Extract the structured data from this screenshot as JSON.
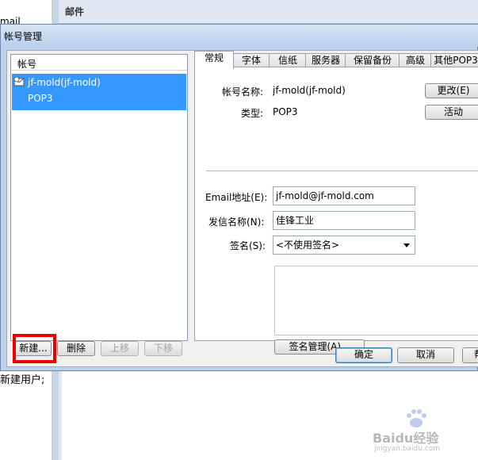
{
  "background": {
    "left_text": "mail",
    "left_text_2": "新建用户;",
    "mail_header": "邮件"
  },
  "dialog": {
    "title": "帐号管理",
    "list": {
      "header": "帐号",
      "account": {
        "name": "jf-mold(jf-mold)",
        "type": "POP3"
      }
    },
    "list_buttons": {
      "new": "新建...",
      "delete": "删除",
      "up": "上移",
      "down": "下移"
    },
    "tabs": [
      "常规",
      "字体",
      "信纸",
      "服务器",
      "保留备份",
      "高级",
      "其他POP3"
    ],
    "general": {
      "account_name_label": "帐号名称:",
      "account_name_value": "jf-mold(jf-mold)",
      "change_button": "更改(E)",
      "type_label": "类型:",
      "type_value": "POP3",
      "activate_button": "活动",
      "email_label": "Email地址(E):",
      "email_value": "jf-mold@jf-mold.com",
      "sender_label": "发信名称(N):",
      "sender_value": "佳锋工业",
      "signature_label": "签名(S):",
      "signature_selected": "<不使用签名>",
      "signature_manage_button": "签名管理(A)..."
    },
    "footer": {
      "ok": "确定",
      "cancel": "取消",
      "help_partial": "帮"
    }
  },
  "watermark": {
    "text": "Baidu经验",
    "subtext": "jingyan.baidu.com"
  },
  "colors": {
    "selection": "#3399ff",
    "highlight_box": "#e60000",
    "title_bar": "#bad1ec"
  }
}
